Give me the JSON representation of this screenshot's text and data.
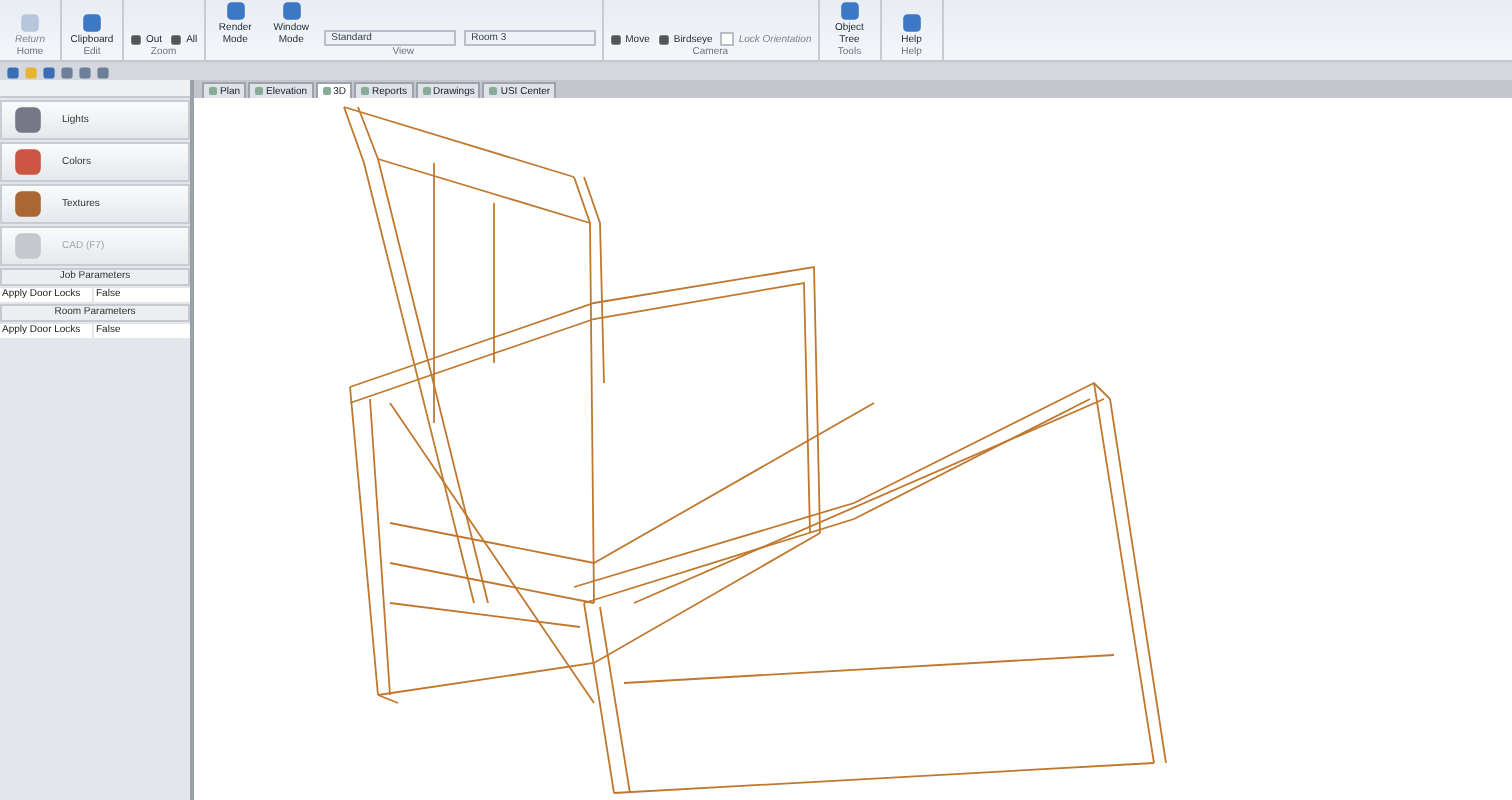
{
  "ribbon": {
    "groups": [
      {
        "label": "Home",
        "items": [
          {
            "kind": "large",
            "label": "Return",
            "disabled": true
          }
        ]
      },
      {
        "label": "Edit",
        "items": [
          {
            "kind": "large",
            "label": "Clipboard",
            "disabled": false
          }
        ]
      },
      {
        "label": "Zoom",
        "items": [
          {
            "kind": "small",
            "label": "Out",
            "disabled": false
          },
          {
            "kind": "small",
            "label": "All",
            "disabled": false
          }
        ]
      },
      {
        "label": "View",
        "items": [
          {
            "kind": "large",
            "label": "Render Mode",
            "disabled": false
          },
          {
            "kind": "large",
            "label": "Window Mode",
            "disabled": false
          },
          {
            "kind": "dropdown",
            "label": "Standard",
            "disabled": false
          },
          {
            "kind": "dropdown",
            "label": "Room 3",
            "disabled": false
          }
        ]
      },
      {
        "label": "Camera",
        "items": [
          {
            "kind": "small",
            "label": "Move",
            "disabled": false
          },
          {
            "kind": "small",
            "label": "Birdseye",
            "disabled": false
          },
          {
            "kind": "checkbox",
            "label": "Lock Orientation",
            "disabled": true,
            "checked": false
          }
        ]
      },
      {
        "label": "Tools",
        "items": [
          {
            "kind": "large",
            "label": "Object Tree",
            "disabled": false
          }
        ]
      },
      {
        "label": "Help",
        "items": [
          {
            "kind": "large",
            "label": "Help",
            "disabled": false
          }
        ]
      }
    ]
  },
  "view_tabs": [
    {
      "label": "Plan",
      "selected": false
    },
    {
      "label": "Elevation",
      "selected": false
    },
    {
      "label": "3D",
      "selected": true
    },
    {
      "label": "Reports",
      "selected": false
    },
    {
      "label": "Drawings",
      "selected": false
    },
    {
      "label": "USI Center",
      "selected": false
    }
  ],
  "side_panel": {
    "tools": [
      {
        "label": "Lights",
        "disabled": false
      },
      {
        "label": "Colors",
        "disabled": false
      },
      {
        "label": "Textures",
        "disabled": false
      },
      {
        "label": "CAD (F7)",
        "disabled": true
      }
    ],
    "sections": [
      {
        "title": "Job Parameters",
        "rows": [
          {
            "name": "Apply Door Locks",
            "value": "False"
          }
        ]
      },
      {
        "title": "Room Parameters",
        "rows": [
          {
            "name": "Apply Door Locks",
            "value": "False"
          }
        ]
      }
    ]
  }
}
